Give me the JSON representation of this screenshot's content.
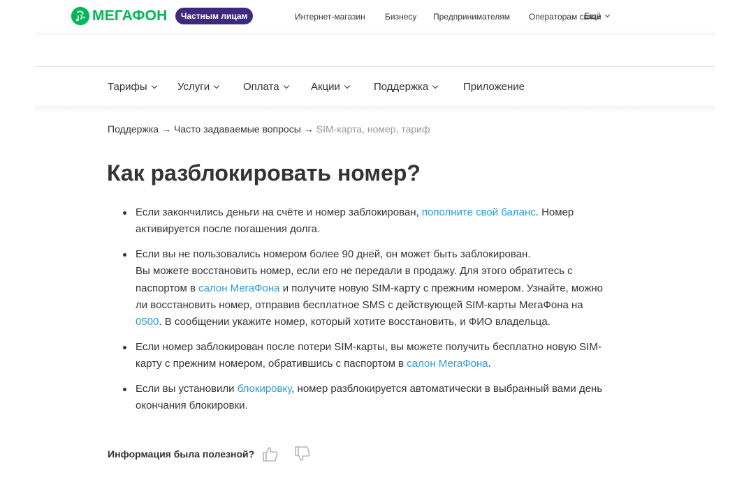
{
  "header": {
    "logo_text": "МегаФон",
    "segment_active": "Частным лицам",
    "top_links": [
      "Интернет-магазин",
      "Бизнесу",
      "Предпринимателям",
      "Операторам связи"
    ],
    "more_label": "Ещё",
    "nav": [
      "Тарифы",
      "Услуги",
      "Оплата",
      "Акции",
      "Поддержка",
      "Приложение"
    ],
    "brand_color": "#00b956",
    "pill_color": "#3d2a7f"
  },
  "breadcrumb": {
    "items": [
      "Поддержка",
      "Часто задаваемые вопросы"
    ],
    "separator": "→",
    "current": "SIM-карта, номер, тариф"
  },
  "page": {
    "title": "Как разблокировать номер?"
  },
  "content": {
    "item1": {
      "text_before": "Если закончились деньги на счёте и номер заблокирован, ",
      "link": "пополните свой баланс",
      "text_after": ". Номер активируется после погашения долга."
    },
    "item2": {
      "line1": "Если вы не пользовались номером более 90 дней, он может быть заблокирован.",
      "text_before_link": "Вы можете восстановить номер, если его не передали в продажу. Для этого обратитесь с паспортом в ",
      "link_salon": "салон МегаФона",
      "text_mid": " и получите новую SIM-карту с прежним номером. Узнайте, можно ли восстановить номер, отправив бесплатное SMS с действующей SIM-карты МегаФона на ",
      "link_number": "0500",
      "text_after": ". В сообщении укажите номер, который хотите восстановить, и ФИО владельца."
    },
    "item3": {
      "text_before": "Если номер заблокирован после потери SIM-карты, вы можете получить бесплатно новую SIM-карту с прежним номером, обратившись с паспортом в ",
      "link": "салон МегаФона",
      "text_after": "."
    },
    "item4": {
      "text_before": "Если вы установили ",
      "link": "блокировку",
      "text_after": ", номер разблокируется автоматически в выбранный вами день окончания блокировки."
    },
    "link_color": "#2b9ae3"
  },
  "feedback": {
    "label": "Информация была полезной?",
    "like_icon": "thumb-up-icon",
    "dislike_icon": "thumb-down-icon"
  }
}
